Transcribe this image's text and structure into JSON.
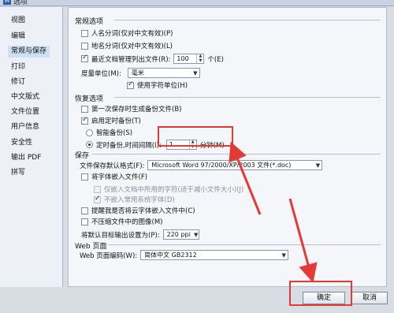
{
  "window": {
    "title": "选项"
  },
  "sidebar": {
    "items": [
      {
        "label": "视图"
      },
      {
        "label": "编辑"
      },
      {
        "label": "常规与保存"
      },
      {
        "label": "打印"
      },
      {
        "label": "修订"
      },
      {
        "label": "中文版式"
      },
      {
        "label": "文件位置"
      },
      {
        "label": "用户信息"
      },
      {
        "label": "安全性"
      },
      {
        "label": "输出 PDF"
      },
      {
        "label": "拼写"
      }
    ],
    "active_index": 2
  },
  "general": {
    "title": "常规选项",
    "name_seg": "人名分词(仅对中文有效)(P)",
    "place_seg": "地名分词(仅对中文有效)(L)",
    "recent_files": "最近文档管理列出文件(R):",
    "recent_count": "100",
    "recent_unit": "个(E)",
    "unit_label": "度量单位(M):",
    "unit_value": "毫米",
    "char_unit": "使用字符单位(H)"
  },
  "backup": {
    "title": "恢复选项",
    "first_save": "第一次保存时生成备份文件(B)",
    "enable_timed": "启用定时备份(T)",
    "smart_backup": "智能备份(S)",
    "timed_backup": "定时备份,时间间隔(I):",
    "interval": "1",
    "interval_unit": "分钟(M)"
  },
  "save": {
    "title": "保存",
    "default_format_label": "文件保存默认格式(F):",
    "default_format": "Microsoft Word 97/2000/XP/2003 文件(*.doc)",
    "embed_fonts": "将字体嵌入文件(F)",
    "embed_used_only": "仅嵌入文档中所用的字符(适于减小文件大小)(J)",
    "no_common_fonts": "不嵌入常用系统字体(D)",
    "prompt_cloud": "提醒我是否将云字体嵌入文件中(C)",
    "no_compress": "不压缩文件中的图像(M)",
    "target_label": "将默认目标输出设置为(P):",
    "target_value": "220 ppi"
  },
  "web": {
    "title": "Web 页面",
    "encoding_label": "Web 页面编码(W):",
    "encoding_value": "简体中文 GB2312"
  },
  "buttons": {
    "ok": "确定",
    "cancel": "取消"
  },
  "colors": {
    "highlight": "#e53935",
    "sidebar_active": "#cfe0f5"
  }
}
